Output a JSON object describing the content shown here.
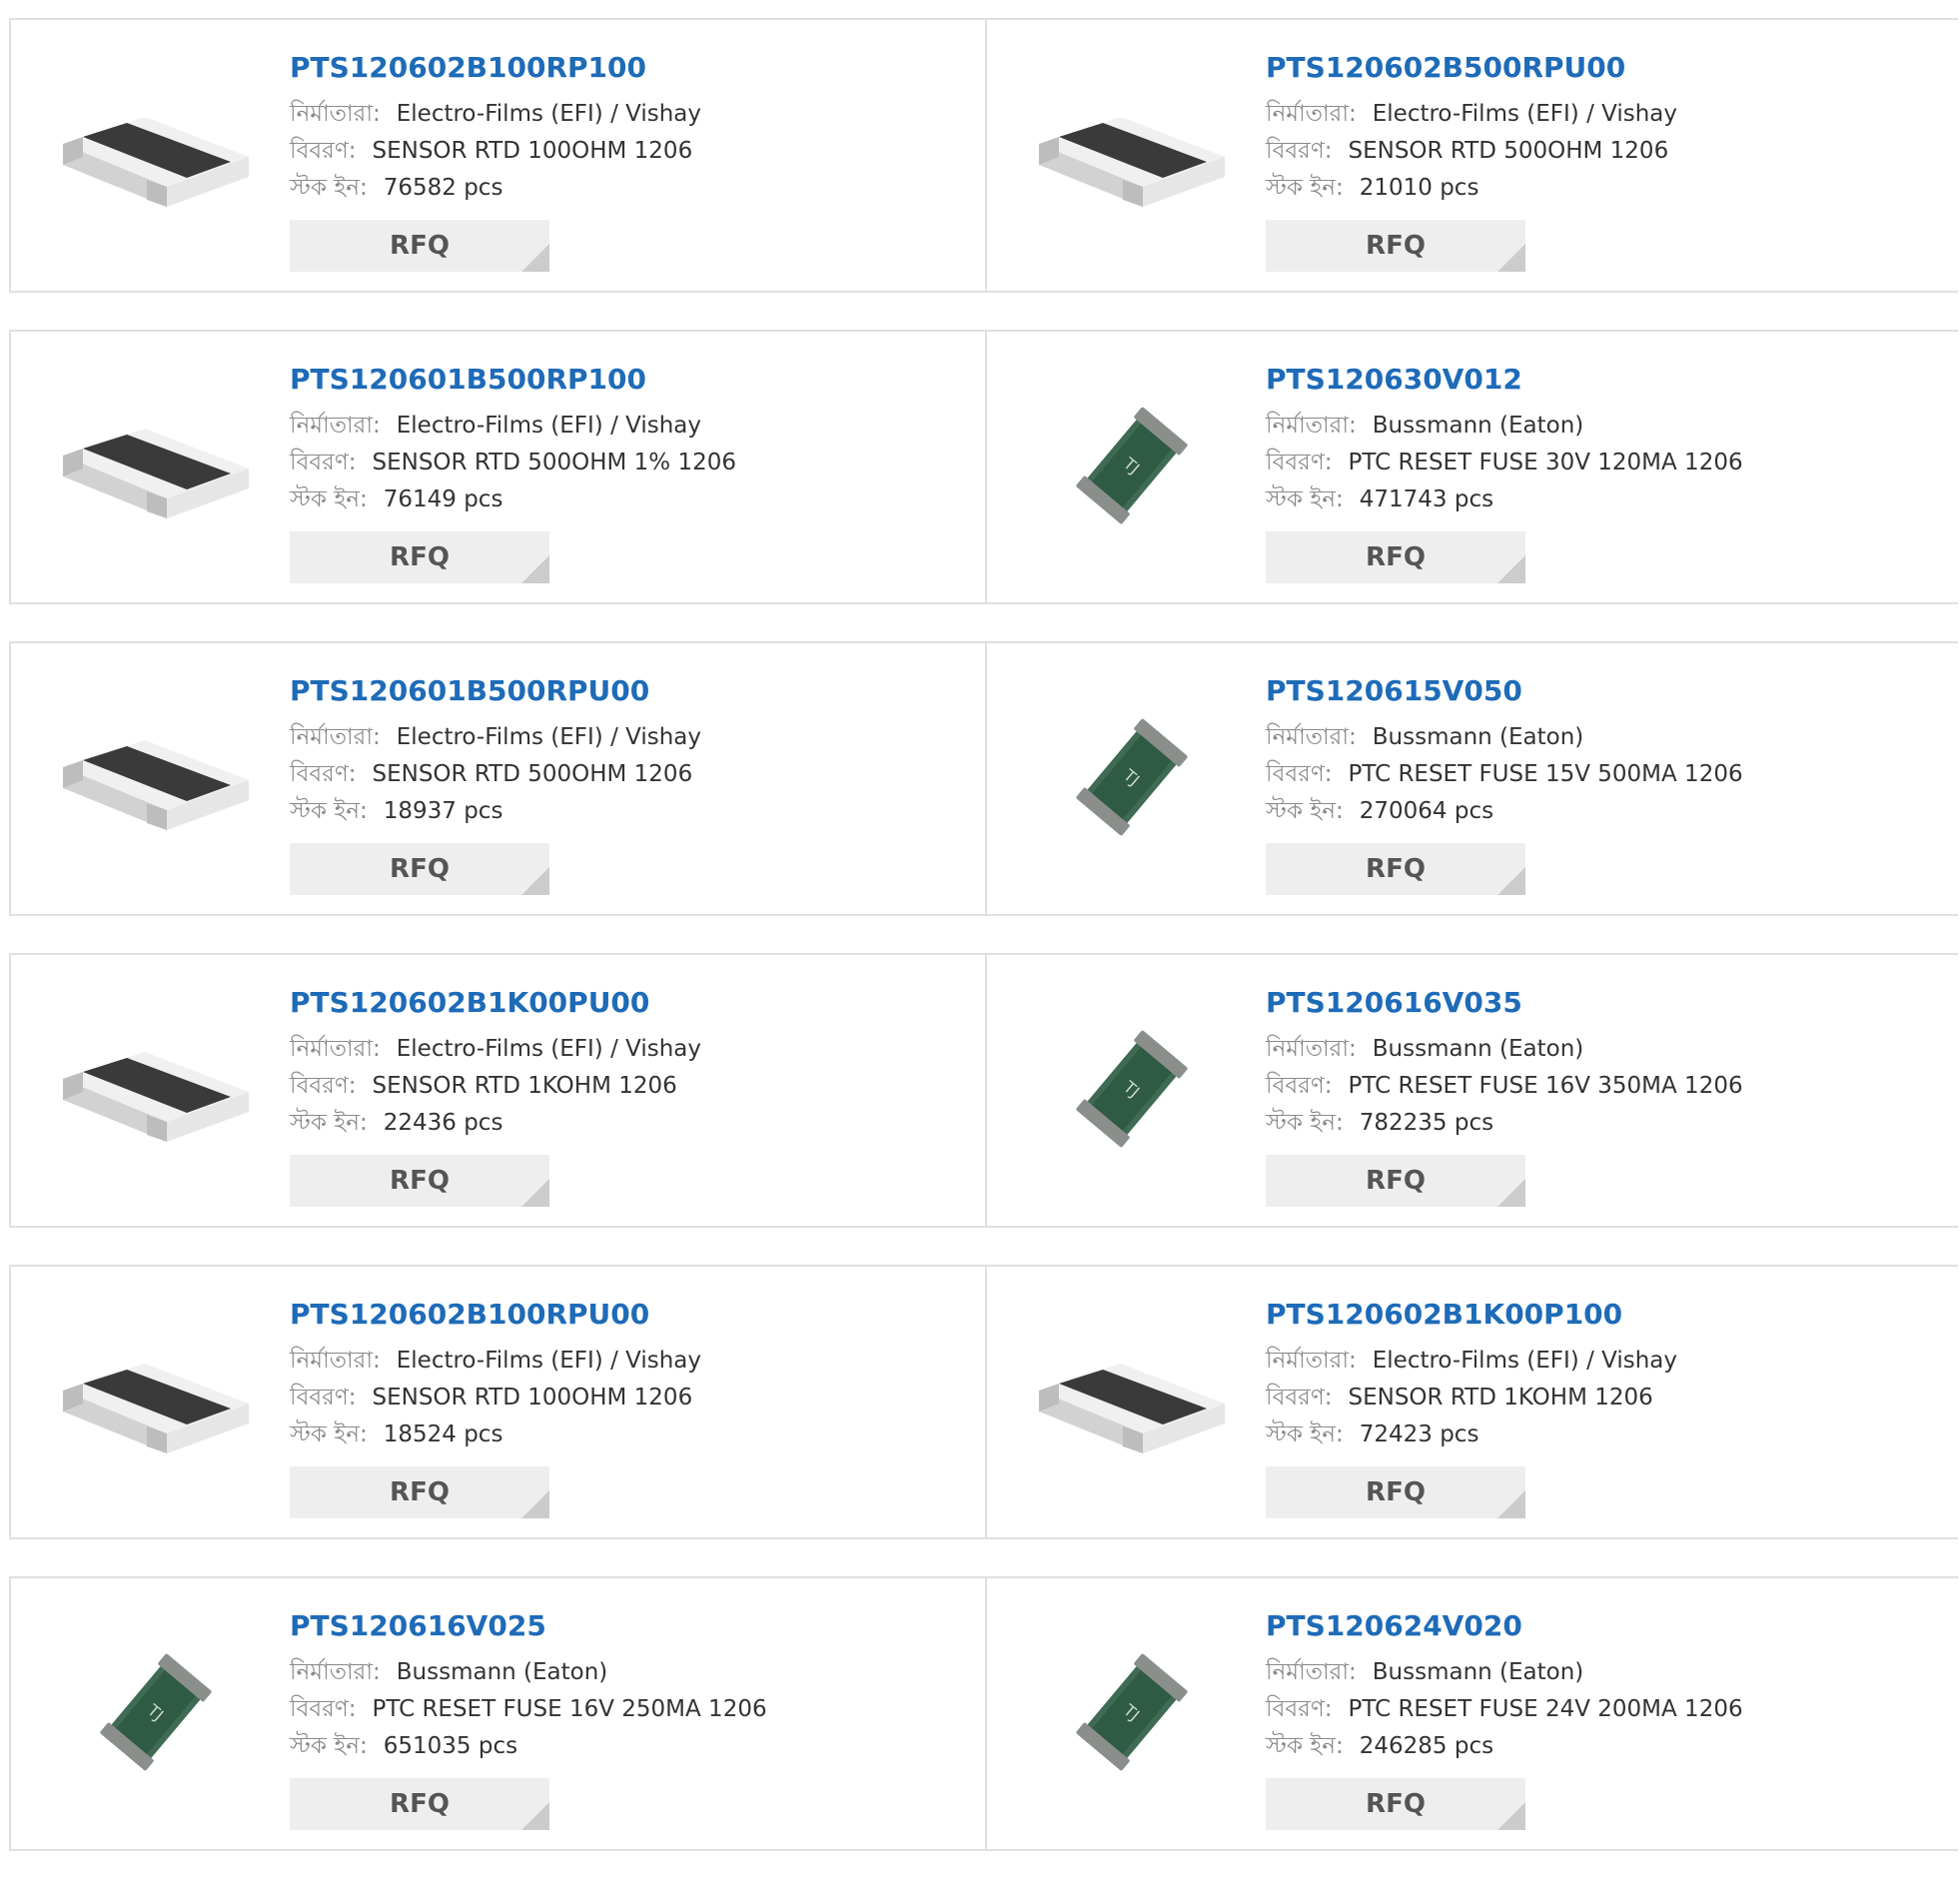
{
  "labels": {
    "manufacturer": "নির্মাতারা:",
    "description": "বিবরণ:",
    "stock": "স্টক ইন:",
    "rfq": "RFQ"
  },
  "products": [
    {
      "part": "PTS120602B100RP100",
      "manufacturer": "Electro-Films (EFI) / Vishay",
      "description": "SENSOR RTD 100OHM 1206",
      "stock": "76582 pcs",
      "image": "rtd-sensor-chip-icon"
    },
    {
      "part": "PTS120602B500RPU00",
      "manufacturer": "Electro-Films (EFI) / Vishay",
      "description": "SENSOR RTD 500OHM 1206",
      "stock": "21010 pcs",
      "image": "rtd-sensor-chip-icon"
    },
    {
      "part": "PTS120601B500RP100",
      "manufacturer": "Electro-Films (EFI) / Vishay",
      "description": "SENSOR RTD 500OHM 1% 1206",
      "stock": "76149 pcs",
      "image": "rtd-sensor-chip-icon"
    },
    {
      "part": "PTS120630V012",
      "manufacturer": "Bussmann (Eaton)",
      "description": "PTC RESET FUSE 30V 120MA 1206",
      "stock": "471743 pcs",
      "image": "ptc-fuse-chip-icon"
    },
    {
      "part": "PTS120601B500RPU00",
      "manufacturer": "Electro-Films (EFI) / Vishay",
      "description": "SENSOR RTD 500OHM 1206",
      "stock": "18937 pcs",
      "image": "rtd-sensor-chip-icon"
    },
    {
      "part": "PTS120615V050",
      "manufacturer": "Bussmann (Eaton)",
      "description": "PTC RESET FUSE 15V 500MA 1206",
      "stock": "270064 pcs",
      "image": "ptc-fuse-chip-icon"
    },
    {
      "part": "PTS120602B1K00PU00",
      "manufacturer": "Electro-Films (EFI) / Vishay",
      "description": "SENSOR RTD 1KOHM 1206",
      "stock": "22436 pcs",
      "image": "rtd-sensor-chip-icon"
    },
    {
      "part": "PTS120616V035",
      "manufacturer": "Bussmann (Eaton)",
      "description": "PTC RESET FUSE 16V 350MA 1206",
      "stock": "782235 pcs",
      "image": "ptc-fuse-chip-icon"
    },
    {
      "part": "PTS120602B100RPU00",
      "manufacturer": "Electro-Films (EFI) / Vishay",
      "description": "SENSOR RTD 100OHM 1206",
      "stock": "18524 pcs",
      "image": "rtd-sensor-chip-icon"
    },
    {
      "part": "PTS120602B1K00P100",
      "manufacturer": "Electro-Films (EFI) / Vishay",
      "description": "SENSOR RTD 1KOHM 1206",
      "stock": "72423 pcs",
      "image": "rtd-sensor-chip-icon"
    },
    {
      "part": "PTS120616V025",
      "manufacturer": "Bussmann (Eaton)",
      "description": "PTC RESET FUSE 16V 250MA 1206",
      "stock": "651035 pcs",
      "image": "ptc-fuse-chip-icon"
    },
    {
      "part": "PTS120624V020",
      "manufacturer": "Bussmann (Eaton)",
      "description": "PTC RESET FUSE 24V 200MA 1206",
      "stock": "246285 pcs",
      "image": "ptc-fuse-chip-icon"
    }
  ],
  "fuse_marking": "TJ",
  "colors": {
    "part_link": "#1e6bb8",
    "label": "#8a8a8a",
    "value": "#333333",
    "rfq_bg": "#eeeeee",
    "rfq_text": "#555555",
    "border": "#e0e0e0"
  }
}
